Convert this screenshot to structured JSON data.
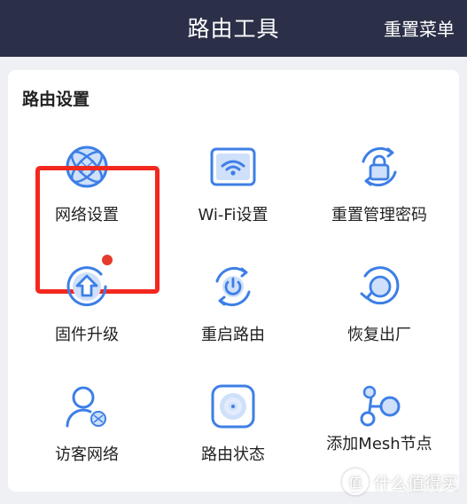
{
  "header": {
    "title": "路由工具",
    "reset_menu": "重置菜单"
  },
  "section": {
    "title": "路由设置"
  },
  "tools": [
    {
      "label": "网络设置",
      "icon": "globe-icon"
    },
    {
      "label": "Wi-Fi设置",
      "icon": "wifi-icon"
    },
    {
      "label": "重置管理密码",
      "icon": "lock-reset-icon"
    },
    {
      "label": "固件升级",
      "icon": "upgrade-icon",
      "has_badge": true
    },
    {
      "label": "重启路由",
      "icon": "power-restart-icon"
    },
    {
      "label": "恢复出厂",
      "icon": "factory-reset-icon"
    },
    {
      "label": "访客网络",
      "icon": "guest-user-icon"
    },
    {
      "label": "路由状态",
      "icon": "router-status-icon"
    },
    {
      "label": "添加Mesh节点",
      "icon": "mesh-node-icon"
    }
  ],
  "watermark": {
    "logo": "值",
    "text": "什么值得买"
  },
  "colors": {
    "header_bg": "#2b2f47",
    "accent": "#3d7fe6",
    "accent_light": "#cfe0fa",
    "highlight": "#f2281f",
    "badge": "#e53b2c"
  }
}
